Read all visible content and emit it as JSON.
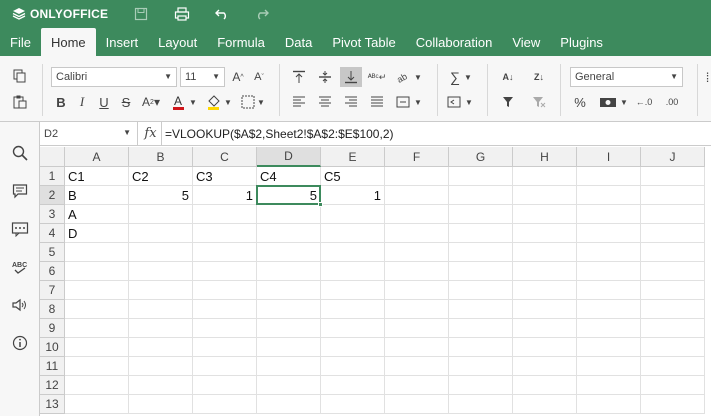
{
  "app": {
    "brand": "ONLYOFFICE"
  },
  "menu": {
    "tabs": [
      "File",
      "Home",
      "Insert",
      "Layout",
      "Formula",
      "Data",
      "Pivot Table",
      "Collaboration",
      "View",
      "Plugins"
    ],
    "active": "Home"
  },
  "toolbar": {
    "font_name": "Calibri",
    "font_size": "11",
    "number_format": "General",
    "bold_label": "B",
    "italic_label": "I",
    "underline_label": "U",
    "strike_label": "S",
    "percent_label": "%"
  },
  "formula_bar": {
    "cell_ref": "D2",
    "fx_label": "fx",
    "formula": "=VLOOKUP($A$2,Sheet2!$A$2:$E$100,2)"
  },
  "sheet": {
    "columns": [
      "A",
      "B",
      "C",
      "D",
      "E",
      "F",
      "G",
      "H",
      "I",
      "J"
    ],
    "rows": [
      "1",
      "2",
      "3",
      "4",
      "5",
      "6",
      "7",
      "8",
      "9",
      "10",
      "11",
      "12",
      "13"
    ],
    "selected_cell": "D2",
    "cells": {
      "A1": "C1",
      "B1": "C2",
      "C1": "C3",
      "D1": "C4",
      "E1": "C5",
      "A2": "B",
      "B2": "5",
      "C2": "1",
      "D2": "5",
      "E2": "1",
      "A3": "A",
      "A4": "D"
    }
  },
  "colors": {
    "brand": "#3d8a5d",
    "font_color_bar": "#d0161b",
    "fill_color_bar": "#ffd800"
  }
}
